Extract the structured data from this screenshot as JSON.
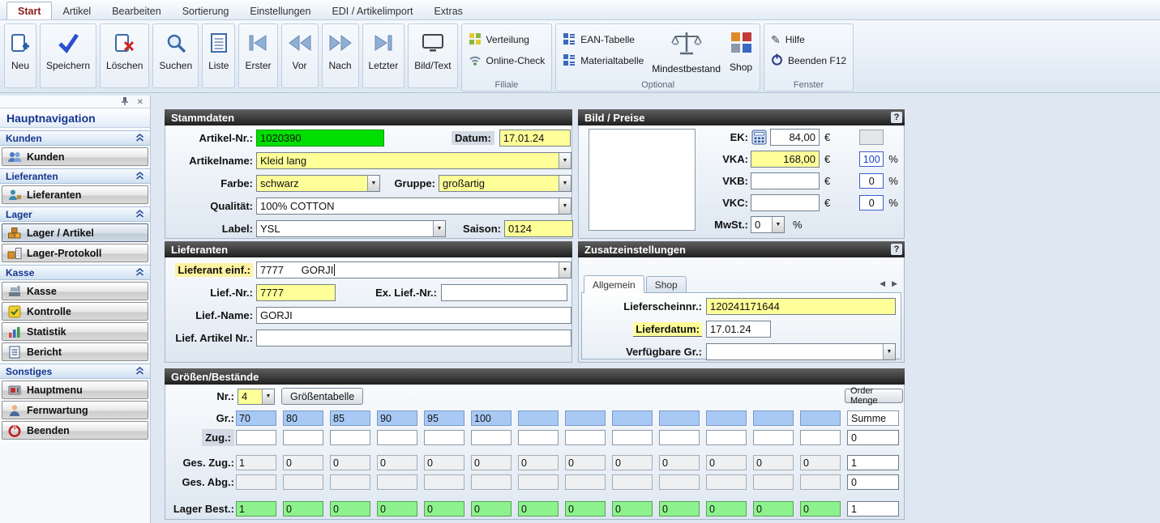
{
  "colors": {
    "field_yellow": "#FFFF99",
    "artikel_green": "#00DF00",
    "grid_blue": "#A9C9F5",
    "grid_green": "#8DF28D",
    "pct_blue": "#1A43C8",
    "section_header": "#2A2A2A",
    "nav_blue": "#16368E"
  },
  "menubar": {
    "tabs": [
      {
        "label": "Start",
        "active": true
      },
      {
        "label": "Artikel"
      },
      {
        "label": "Bearbeiten"
      },
      {
        "label": "Sortierung"
      },
      {
        "label": "Einstellungen"
      },
      {
        "label": "EDI / Artikelimport"
      },
      {
        "label": "Extras"
      }
    ]
  },
  "ribbon": {
    "buttons": [
      {
        "label": "Neu",
        "icon": "new-record-icon"
      },
      {
        "label": "Speichern",
        "icon": "save-check-icon"
      },
      {
        "label": "Löschen",
        "icon": "delete-icon"
      },
      {
        "label": "Suchen",
        "icon": "search-icon"
      },
      {
        "label": "Liste",
        "icon": "list-icon"
      },
      {
        "label": "Erster",
        "icon": "first-record-icon"
      },
      {
        "label": "Vor",
        "icon": "previous-record-icon"
      },
      {
        "label": "Nach",
        "icon": "next-record-icon"
      },
      {
        "label": "Letzter",
        "icon": "last-record-icon"
      },
      {
        "label": "Bild/Text",
        "icon": "image-text-icon"
      }
    ],
    "groups": [
      {
        "label": "Filiale",
        "items": [
          {
            "label": "Verteilung",
            "icon": "distribution-icon"
          },
          {
            "label": "Online-Check",
            "icon": "online-check-icon"
          }
        ]
      },
      {
        "label": "Optional",
        "items": [
          {
            "label": "EAN-Tabelle",
            "icon": "ean-table-icon"
          },
          {
            "label": "Materialtabelle",
            "icon": "material-table-icon"
          },
          {
            "label": "Mindestbestand",
            "icon": "min-stock-icon"
          },
          {
            "label": "Shop",
            "icon": "shop-icon"
          }
        ]
      },
      {
        "label": "Fenster",
        "items": [
          {
            "label": "Hilfe",
            "icon": "help-icon"
          },
          {
            "label": "Beenden F12",
            "icon": "exit-icon"
          }
        ]
      }
    ]
  },
  "sidebar": {
    "title": "Hauptnavigation",
    "sections": [
      {
        "header": "Kunden",
        "items": [
          {
            "label": "Kunden",
            "icon": "customers-icon"
          }
        ]
      },
      {
        "header": "Lieferanten",
        "items": [
          {
            "label": "Lieferanten",
            "icon": "suppliers-icon"
          }
        ]
      },
      {
        "header": "Lager",
        "items": [
          {
            "label": "Lager / Artikel",
            "icon": "warehouse-articles-icon",
            "selected": true
          },
          {
            "label": "Lager-Protokoll",
            "icon": "warehouse-log-icon"
          }
        ]
      },
      {
        "header": "Kasse",
        "items": [
          {
            "label": "Kasse",
            "icon": "cash-register-icon"
          },
          {
            "label": "Kontrolle",
            "icon": "control-icon"
          },
          {
            "label": "Statistik",
            "icon": "statistics-icon"
          },
          {
            "label": "Bericht",
            "icon": "report-icon"
          }
        ]
      },
      {
        "header": "Sonstiges",
        "items": [
          {
            "label": "Hauptmenu",
            "icon": "main-menu-icon"
          },
          {
            "label": "Fernwartung",
            "icon": "remote-support-icon"
          },
          {
            "label": "Beenden",
            "icon": "power-icon"
          }
        ]
      }
    ]
  },
  "stammdaten": {
    "title": "Stammdaten",
    "artikel_nr_label": "Artikel-Nr.:",
    "artikel_nr": "1020390",
    "datum_label": "Datum:",
    "datum": "17.01.24",
    "artikelname_label": "Artikelname:",
    "artikelname": "Kleid lang",
    "farbe_label": "Farbe:",
    "farbe": "schwarz",
    "gruppe_label": "Gruppe:",
    "gruppe": "großartig",
    "qualitaet_label": "Qualität:",
    "qualitaet": "100% COTTON",
    "label_label": "Label:",
    "label_value": "YSL",
    "saison_label": "Saison:",
    "saison": "0124"
  },
  "bild_preise": {
    "title": "Bild / Preise",
    "help": "?",
    "ek_label": "EK:",
    "ek": "84,00",
    "vka_label": "VKA:",
    "vka": "168,00",
    "vka_pct": "100",
    "vkb_label": "VKB:",
    "vkb": "",
    "vkb_pct": "0",
    "vkc_label": "VKC:",
    "vkc": "",
    "vkc_pct": "0",
    "mwst_label": "MwSt.:",
    "mwst": "0",
    "currency": "€",
    "percent": "%"
  },
  "lieferanten": {
    "title": "Lieferanten",
    "lieferant_einf_label": "Lieferant einf.:",
    "lieferant_einf": "7777      GORJI",
    "lief_nr_label": "Lief.-Nr.:",
    "lief_nr": "7777",
    "ex_lief_nr_label": "Ex. Lief.-Nr.:",
    "ex_lief_nr": "",
    "lief_name_label": "Lief.-Name:",
    "lief_name": "GORJI",
    "lief_artikel_nr_label": "Lief. Artikel Nr.:",
    "lief_artikel_nr": ""
  },
  "zusatz": {
    "title": "Zusatzeinstellungen",
    "help": "?",
    "tabs": [
      {
        "label": "Allgemein",
        "active": true
      },
      {
        "label": "Shop",
        "active": false
      }
    ],
    "lieferscheinnr_label": "Lieferscheinnr.:",
    "lieferscheinnr": "120241171644",
    "lieferdatum_label": "Lieferdatum:",
    "lieferdatum": "17.01.24",
    "verfuegbare_label": "Verfügbare Gr.:",
    "verfuegbare": ""
  },
  "groessen": {
    "title": "Größen/Bestände",
    "nr_label": "Nr.:",
    "nr_value": "4",
    "groessentabelle_button": "Größentabelle",
    "order_menge_button": "Order Menge",
    "summe_header": "Summe",
    "rows": {
      "gr": {
        "label": "Gr.:",
        "cells": [
          "70",
          "80",
          "85",
          "90",
          "95",
          "100",
          "",
          "",
          "",
          "",
          "",
          "",
          ""
        ]
      },
      "zug": {
        "label": "Zug.:",
        "cells": [
          "",
          "",
          "",
          "",
          "",
          "",
          "",
          "",
          "",
          "",
          "",
          "",
          ""
        ],
        "summe": "0"
      },
      "ges_zug": {
        "label": "Ges. Zug.:",
        "cells": [
          "1",
          "0",
          "0",
          "0",
          "0",
          "0",
          "0",
          "0",
          "0",
          "0",
          "0",
          "0",
          "0"
        ],
        "summe": "1"
      },
      "ges_abg": {
        "label": "Ges. Abg.:",
        "cells": [
          "",
          "",
          "",
          "",
          "",
          "",
          "",
          "",
          "",
          "",
          "",
          "",
          ""
        ],
        "summe": "0"
      },
      "lager_best": {
        "label": "Lager Best.:",
        "cells": [
          "1",
          "0",
          "0",
          "0",
          "0",
          "0",
          "0",
          "0",
          "0",
          "0",
          "0",
          "0",
          "0"
        ],
        "summe": "1"
      }
    }
  }
}
